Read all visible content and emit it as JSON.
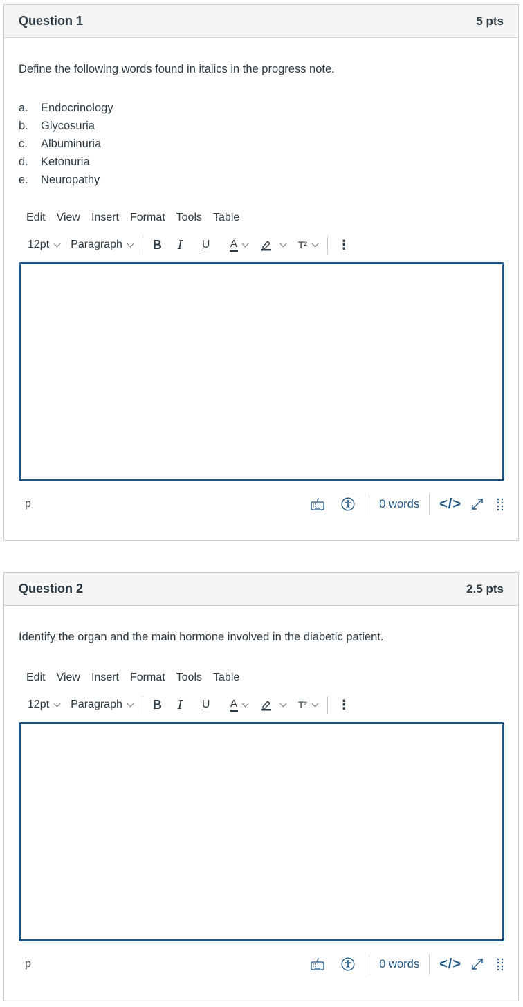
{
  "questions": [
    {
      "title": "Question 1",
      "points": "5 pts",
      "prompt": "Define the following words found in italics in the progress note.",
      "options": [
        {
          "letter": "a.",
          "text": "Endocrinology"
        },
        {
          "letter": "b.",
          "text": "Glycosuria"
        },
        {
          "letter": "c.",
          "text": "Albuminuria"
        },
        {
          "letter": "d.",
          "text": "Ketonuria"
        },
        {
          "letter": "e.",
          "text": "Neuropathy"
        }
      ],
      "editor": {
        "menus": [
          "Edit",
          "View",
          "Insert",
          "Format",
          "Tools",
          "Table"
        ],
        "font_size": "12pt",
        "block_format": "Paragraph",
        "bold_label": "B",
        "italic_label": "I",
        "underline_label": "U",
        "text_color_label": "A",
        "superscript_label": "T²",
        "more_label": "⋮",
        "content": "",
        "path": "p",
        "word_count": "0 words",
        "html_editor_label": "</>"
      }
    },
    {
      "title": "Question 2",
      "points": "2.5 pts",
      "prompt": "Identify the organ and the main hormone involved in the diabetic patient.",
      "editor": {
        "menus": [
          "Edit",
          "View",
          "Insert",
          "Format",
          "Tools",
          "Table"
        ],
        "font_size": "12pt",
        "block_format": "Paragraph",
        "bold_label": "B",
        "italic_label": "I",
        "underline_label": "U",
        "text_color_label": "A",
        "superscript_label": "T²",
        "more_label": "⋮",
        "content": "",
        "path": "p",
        "word_count": "0 words",
        "html_editor_label": "</>"
      }
    }
  ],
  "colors": {
    "text": "#2d3b45",
    "accent": "#1f5585",
    "border": "#c7cdd1",
    "header_bg": "#f5f5f5"
  }
}
